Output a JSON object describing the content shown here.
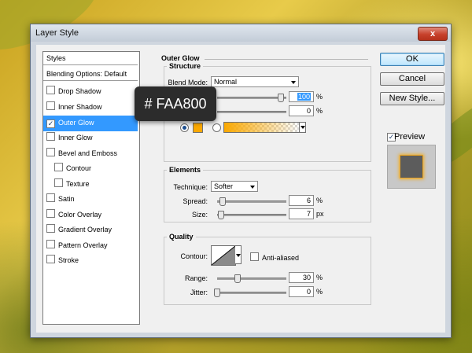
{
  "window": {
    "title": "Layer Style",
    "close_glyph": "x"
  },
  "styles_list": {
    "header": "Styles",
    "blending": "Blending Options: Default",
    "items": [
      {
        "label": "Drop Shadow",
        "checked": false
      },
      {
        "label": "Inner Shadow",
        "checked": false
      },
      {
        "label": "Outer Glow",
        "checked": true
      },
      {
        "label": "Inner Glow",
        "checked": false
      },
      {
        "label": "Bevel and Emboss",
        "checked": false
      },
      {
        "label": "Contour",
        "checked": false
      },
      {
        "label": "Texture",
        "checked": false
      },
      {
        "label": "Satin",
        "checked": false
      },
      {
        "label": "Color Overlay",
        "checked": false
      },
      {
        "label": "Gradient Overlay",
        "checked": false
      },
      {
        "label": "Pattern Overlay",
        "checked": false
      },
      {
        "label": "Stroke",
        "checked": false
      }
    ],
    "check_glyph": "✓"
  },
  "outer_glow": {
    "title": "Outer Glow",
    "structure": {
      "title": "Structure",
      "blend_mode_label": "Blend Mode:",
      "blend_mode": "Normal",
      "opacity_value": "100",
      "opacity_unit": "%",
      "noise_value": "0",
      "noise_unit": "%",
      "color": "#FAA800"
    },
    "elements": {
      "title": "Elements",
      "technique_label": "Technique:",
      "technique": "Softer",
      "spread_label": "Spread:",
      "spread_value": "6",
      "spread_unit": "%",
      "size_label": "Size:",
      "size_value": "7",
      "size_unit": "px"
    },
    "quality": {
      "title": "Quality",
      "contour_label": "Contour:",
      "anti_aliased_label": "Anti-aliased",
      "range_label": "Range:",
      "range_value": "30",
      "range_unit": "%",
      "jitter_label": "Jitter:",
      "jitter_value": "0",
      "jitter_unit": "%"
    }
  },
  "buttons": {
    "ok": "OK",
    "cancel": "Cancel",
    "new_style": "New Style...",
    "preview": "Preview"
  },
  "tooltip": {
    "text": "# FAA800"
  }
}
